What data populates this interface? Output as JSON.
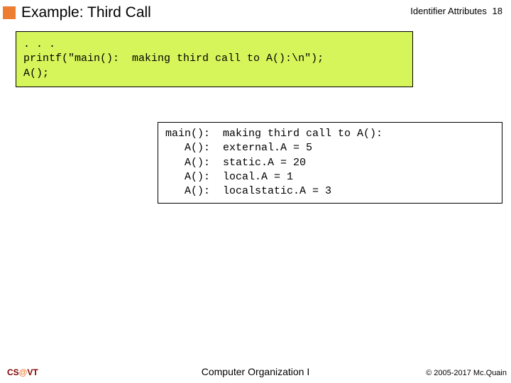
{
  "header": {
    "title": "Example:  Third Call",
    "category": "Identifier Attributes",
    "page": "18"
  },
  "code": ". . .\nprintf(\"main():  making third call to A():\\n\");\nA();",
  "output": "main():  making third call to A():\n   A():  external.A = 5\n   A():  static.A = 20\n   A():  local.A = 1\n   A():  localstatic.A = 3",
  "footer": {
    "left_cs": "CS",
    "left_at": "@",
    "left_vt": "VT",
    "center": "Computer Organization I",
    "right": "© 2005-2017 Mc.Quain"
  }
}
